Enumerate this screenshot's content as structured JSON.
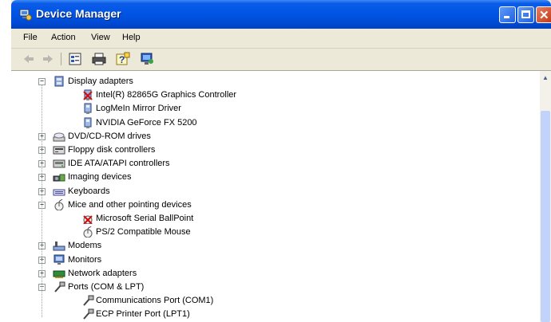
{
  "window": {
    "title": "Device Manager"
  },
  "menu": [
    "File",
    "Action",
    "View",
    "Help"
  ],
  "toolbar": {
    "icons": [
      "back-arrow-icon",
      "forward-arrow-icon",
      "properties-icon",
      "print-icon",
      "help-icon",
      "scan-hardware-icon"
    ]
  },
  "tree": [
    {
      "label": "Display adapters",
      "level": 1,
      "expanded": true,
      "icon": "display-adapter-icon"
    },
    {
      "label": "Intel(R) 82865G Graphics Controller",
      "level": 2,
      "icon": "display-device-disabled-icon"
    },
    {
      "label": "LogMeIn Mirror Driver",
      "level": 2,
      "icon": "display-device-icon"
    },
    {
      "label": "NVIDIA GeForce FX 5200",
      "level": 2,
      "icon": "display-device-icon"
    },
    {
      "label": "DVD/CD-ROM drives",
      "level": 1,
      "expanded": false,
      "icon": "cdrom-icon"
    },
    {
      "label": "Floppy disk controllers",
      "level": 1,
      "expanded": false,
      "icon": "floppy-controller-icon"
    },
    {
      "label": "IDE ATA/ATAPI controllers",
      "level": 1,
      "expanded": false,
      "icon": "ide-controller-icon"
    },
    {
      "label": "Imaging devices",
      "level": 1,
      "expanded": false,
      "icon": "imaging-device-icon"
    },
    {
      "label": "Keyboards",
      "level": 1,
      "expanded": false,
      "icon": "keyboard-icon"
    },
    {
      "label": "Mice and other pointing devices",
      "level": 1,
      "expanded": true,
      "icon": "mouse-icon"
    },
    {
      "label": "Microsoft Serial BallPoint",
      "level": 2,
      "icon": "mouse-disabled-icon"
    },
    {
      "label": "PS/2 Compatible Mouse",
      "level": 2,
      "icon": "mouse-icon"
    },
    {
      "label": "Modems",
      "level": 1,
      "expanded": false,
      "icon": "modem-icon"
    },
    {
      "label": "Monitors",
      "level": 1,
      "expanded": false,
      "icon": "monitor-icon"
    },
    {
      "label": "Network adapters",
      "level": 1,
      "expanded": false,
      "icon": "network-adapter-icon"
    },
    {
      "label": "Ports (COM & LPT)",
      "level": 1,
      "expanded": true,
      "icon": "port-icon"
    },
    {
      "label": "Communications Port (COM1)",
      "level": 2,
      "icon": "port-icon"
    },
    {
      "label": "ECP Printer Port (LPT1)",
      "level": 2,
      "icon": "port-icon"
    }
  ]
}
